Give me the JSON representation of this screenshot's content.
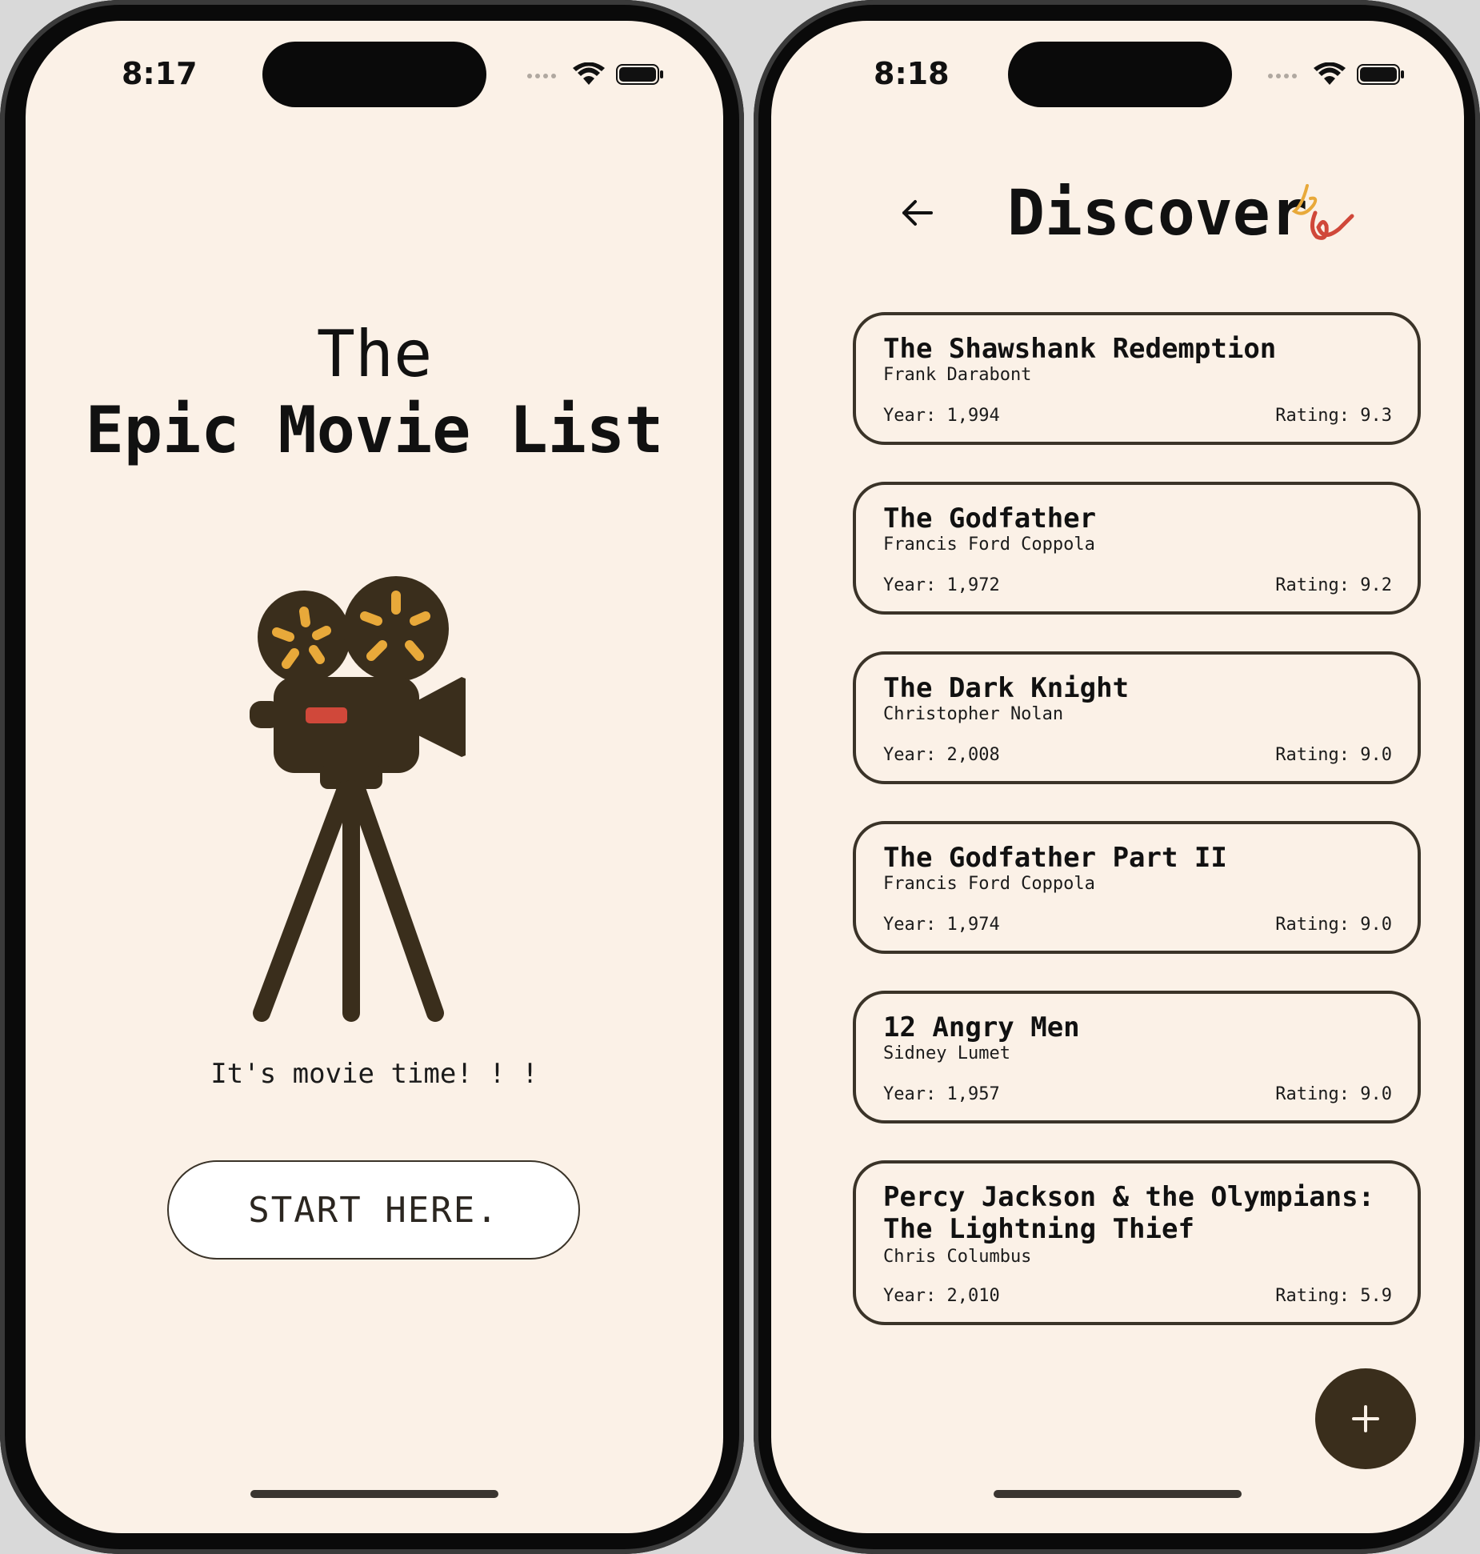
{
  "colors": {
    "background": "#fbf1e7",
    "ink": "#3a2e1c",
    "accent_yellow": "#e8a93a",
    "accent_red": "#d0483a"
  },
  "left_screen": {
    "status_time": "8:17",
    "title_line1": "The",
    "title_line2": "Epic Movie List",
    "illustration": "movie-camera-on-tripod",
    "tagline": "It's movie time! ! !",
    "start_button_label": "START HERE."
  },
  "right_screen": {
    "status_time": "8:18",
    "back_icon": "arrow-left-icon",
    "title": "Discover",
    "title_decoration": "squiggle-icon",
    "movies": [
      {
        "title": "The Shawshank Redemption",
        "director": "Frank Darabont",
        "year": "Year: 1,994",
        "rating": "Rating: 9.3"
      },
      {
        "title": "The Godfather",
        "director": "Francis Ford Coppola",
        "year": "Year: 1,972",
        "rating": "Rating: 9.2"
      },
      {
        "title": "The Dark Knight",
        "director": "Christopher Nolan",
        "year": "Year: 2,008",
        "rating": "Rating: 9.0"
      },
      {
        "title": "The Godfather Part II",
        "director": "Francis Ford Coppola",
        "year": "Year: 1,974",
        "rating": "Rating: 9.0"
      },
      {
        "title": "12 Angry Men",
        "director": "Sidney Lumet",
        "year": "Year: 1,957",
        "rating": "Rating: 9.0"
      },
      {
        "title": "Percy Jackson & the Olympians: The Lightning Thief",
        "director": "Chris Columbus",
        "year": "Year: 2,010",
        "rating": "Rating: 5.9"
      }
    ],
    "fab_icon": "plus-icon"
  }
}
